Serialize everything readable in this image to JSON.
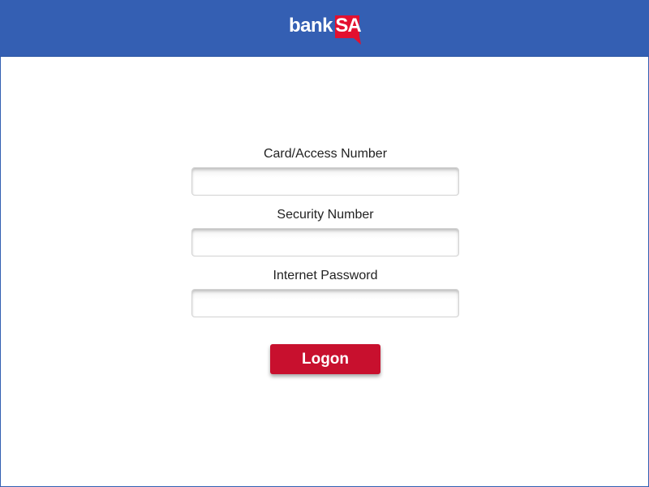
{
  "header": {
    "logo_word": "bank",
    "logo_badge": "SA",
    "background_color": "#345fb3",
    "badge_color": "#e3102f"
  },
  "login_form": {
    "fields": [
      {
        "label": "Card/Access Number",
        "value": "",
        "placeholder": ""
      },
      {
        "label": "Security Number",
        "value": "",
        "placeholder": ""
      },
      {
        "label": "Internet Password",
        "value": "",
        "placeholder": ""
      }
    ],
    "submit_label": "Logon",
    "submit_color": "#c8102e"
  }
}
